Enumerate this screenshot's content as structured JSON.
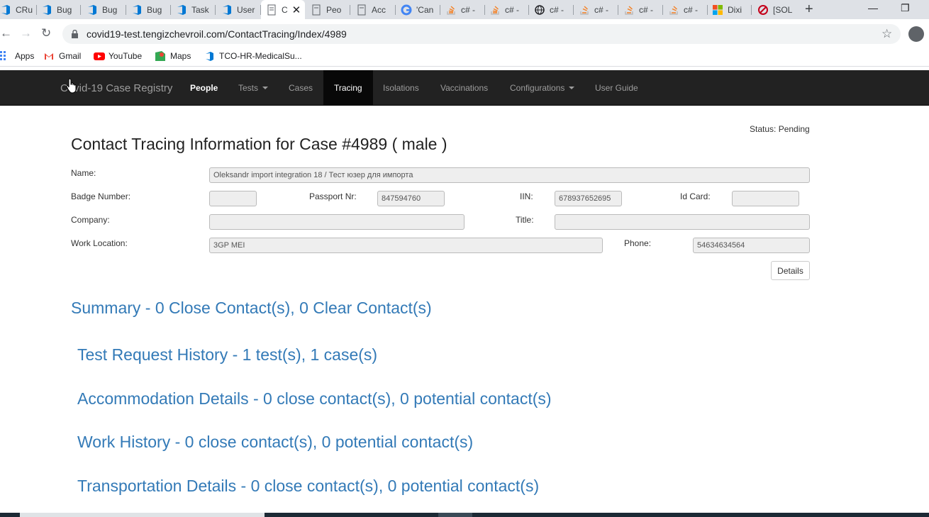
{
  "browser": {
    "tabs": [
      {
        "label": "CRu",
        "icon": "azure-devops-icon"
      },
      {
        "label": "Bug",
        "icon": "azure-devops-icon"
      },
      {
        "label": "Bug",
        "icon": "azure-devops-icon"
      },
      {
        "label": "Bug",
        "icon": "azure-devops-icon"
      },
      {
        "label": "Task",
        "icon": "azure-devops-icon"
      },
      {
        "label": "User",
        "icon": "azure-devops-icon"
      },
      {
        "label": "C",
        "icon": "page-icon"
      },
      {
        "label": "Peo",
        "icon": "page-icon"
      },
      {
        "label": "Acc",
        "icon": "page-icon"
      },
      {
        "label": "'Can",
        "icon": "google-icon"
      },
      {
        "label": "c# -",
        "icon": "stackoverflow-icon"
      },
      {
        "label": "c# -",
        "icon": "stackoverflow-icon"
      },
      {
        "label": "c# -",
        "icon": "web-icon"
      },
      {
        "label": "c# -",
        "icon": "stackoverflow-icon"
      },
      {
        "label": "c# -",
        "icon": "stackoverflow-icon"
      },
      {
        "label": "c# -",
        "icon": "stackoverflow-icon"
      },
      {
        "label": "Dixi",
        "icon": "microsoft-icon"
      },
      {
        "label": "[SOL",
        "icon": "red-logo-icon"
      }
    ],
    "active_tab_index": 6,
    "url": "covid19-test.tengizchevroil.com/ContactTracing/Index/4989",
    "bookmarks": [
      {
        "label": "Apps",
        "icon": "apps-grid-icon"
      },
      {
        "label": "Gmail",
        "icon": "gmail-icon"
      },
      {
        "label": "YouTube",
        "icon": "youtube-icon"
      },
      {
        "label": "Maps",
        "icon": "maps-icon"
      },
      {
        "label": "TCO-HR-MedicalSu...",
        "icon": "azure-devops-icon"
      }
    ]
  },
  "app": {
    "brand": "Covid-19 Case Registry",
    "nav": [
      {
        "label": "People"
      },
      {
        "label": "Tests"
      },
      {
        "label": "Cases"
      },
      {
        "label": "Tracing"
      },
      {
        "label": "Isolations"
      },
      {
        "label": "Vaccinations"
      },
      {
        "label": "Configurations"
      },
      {
        "label": "User Guide"
      }
    ]
  },
  "page": {
    "status_label": "Status: Pending",
    "title": "Contact Tracing Information for Case #4989 ( male )",
    "labels": {
      "name": "Name:",
      "badge": "Badge Number:",
      "passport": "Passport Nr:",
      "iin": "IIN:",
      "id_card": "Id Card:",
      "company": "Company:",
      "title": "Title:",
      "work_location": "Work Location:",
      "phone": "Phone:"
    },
    "values": {
      "name": "Oleksandr import integration 18 / Тест юзер для импорта",
      "badge": "",
      "passport": "847594760",
      "iin": "678937652695",
      "id_card": "",
      "company": "",
      "title": "",
      "work_location": "3GP MEI",
      "phone": "54634634564"
    },
    "details_button": "Details",
    "sections": {
      "summary": "Summary - 0 Close Contact(s), 0 Clear Contact(s)",
      "tests": "Test Request History - 1 test(s), 1 case(s)",
      "accommodation": "Accommodation Details - 0 close contact(s), 0 potential contact(s)",
      "work": "Work History - 0 close contact(s), 0 potential contact(s)",
      "transportation": "Transportation Details - 0 close contact(s), 0 potential contact(s)"
    }
  },
  "colors": {
    "navbar_bg": "#222222",
    "active_nav_bg": "#080808",
    "link_blue": "#337ab7",
    "field_bg": "#eeeeee"
  }
}
